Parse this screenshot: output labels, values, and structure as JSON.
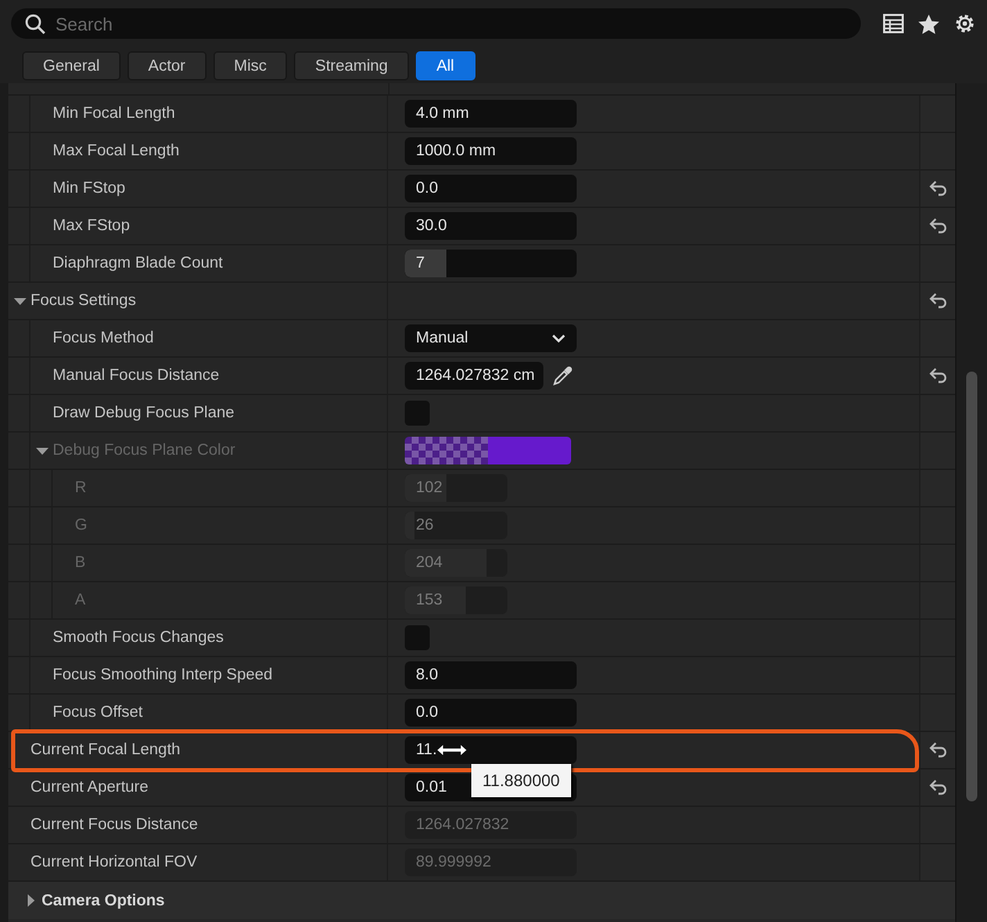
{
  "search": {
    "placeholder": "Search"
  },
  "tabs": [
    {
      "label": "General",
      "selected": false
    },
    {
      "label": "Actor",
      "selected": false
    },
    {
      "label": "Misc",
      "selected": false
    },
    {
      "label": "Streaming",
      "selected": false
    },
    {
      "label": "All",
      "selected": true
    }
  ],
  "rows": [
    {
      "kind": "group",
      "children": [
        {
          "kind": "number",
          "label": "Min Focal Length",
          "value": "4.0 mm",
          "reset": false
        },
        {
          "kind": "number",
          "label": "Max Focal Length",
          "value": "1000.0 mm",
          "reset": false
        },
        {
          "kind": "number",
          "label": "Min FStop",
          "value": "0.0",
          "reset": true
        },
        {
          "kind": "number",
          "label": "Max FStop",
          "value": "30.0",
          "reset": true
        },
        {
          "kind": "slider",
          "label": "Diaphragm Blade Count",
          "value": "7",
          "level": 0.24,
          "reset": false
        }
      ]
    },
    {
      "kind": "category",
      "label": "Focus Settings",
      "expanded": true,
      "reset": true,
      "children": [
        {
          "kind": "dropdown",
          "label": "Focus Method",
          "value": "Manual",
          "reset": false
        },
        {
          "kind": "number",
          "label": "Manual Focus Distance",
          "value": "1264.027832 cm",
          "picker": true,
          "reset": true
        },
        {
          "kind": "checkbox",
          "label": "Draw Debug Focus Plane",
          "checked": false,
          "reset": false
        },
        {
          "kind": "color",
          "label": "Debug Focus Plane Color",
          "color": "#661acc",
          "expanded": true,
          "disabled": true,
          "reset": false,
          "children": [
            {
              "kind": "slider",
              "label": "R",
              "value": "102",
              "level": 0.4,
              "disabled": true,
              "reset": false
            },
            {
              "kind": "slider",
              "label": "G",
              "value": "26",
              "level": 0.1,
              "disabled": true,
              "reset": false
            },
            {
              "kind": "slider",
              "label": "B",
              "value": "204",
              "level": 0.8,
              "disabled": true,
              "reset": false
            },
            {
              "kind": "slider",
              "label": "A",
              "value": "153",
              "level": 0.6,
              "disabled": true,
              "reset": false
            }
          ]
        },
        {
          "kind": "checkbox",
          "label": "Smooth Focus Changes",
          "checked": false,
          "reset": false
        },
        {
          "kind": "number",
          "label": "Focus Smoothing Interp Speed",
          "value": "8.0",
          "reset": false
        },
        {
          "kind": "number",
          "label": "Focus Offset",
          "value": "0.0",
          "reset": false
        }
      ]
    },
    {
      "kind": "number",
      "label": "Current Focal Length",
      "value": "11.",
      "highlighted": true,
      "tooltip": "11.880000",
      "reset": true
    },
    {
      "kind": "number",
      "label": "Current Aperture",
      "value": "0.01",
      "reset": true
    },
    {
      "kind": "readonly",
      "label": "Current Focus Distance",
      "value": "1264.027832",
      "reset": false
    },
    {
      "kind": "readonly",
      "label": "Current Horizontal FOV",
      "value": "89.999992",
      "reset": false
    },
    {
      "kind": "section",
      "label": "Camera Options",
      "expanded": false
    }
  ]
}
